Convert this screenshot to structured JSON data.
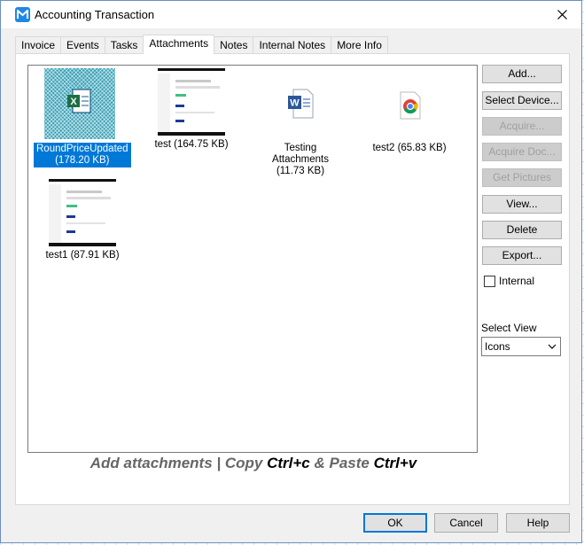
{
  "window": {
    "title": "Accounting Transaction",
    "accent": "#0078d7"
  },
  "tabs": [
    {
      "label": "Invoice"
    },
    {
      "label": "Events"
    },
    {
      "label": "Tasks"
    },
    {
      "label": "Attachments",
      "active": true
    },
    {
      "label": "Notes"
    },
    {
      "label": "Internal Notes"
    },
    {
      "label": "More Info"
    }
  ],
  "attachments": [
    {
      "name": "RoundPriceUpdated",
      "size": "(178.20 KB)",
      "icon": "excel-file-icon",
      "selected": true
    },
    {
      "name": "test (164.75 KB)",
      "size": "",
      "icon": "screenshot-thumbnail"
    },
    {
      "name": "Testing Attachments",
      "size": "(11.73 KB)",
      "icon": "word-file-icon"
    },
    {
      "name": "test2 (65.83 KB)",
      "size": "",
      "icon": "chrome-file-icon"
    },
    {
      "name": "test1 (87.91 KB)",
      "size": "",
      "icon": "screenshot-thumbnail"
    }
  ],
  "buttons": {
    "add": "Add...",
    "select_device": "Select Device...",
    "acquire": "Acquire...",
    "acquire_doc": "Acquire Doc...",
    "get_pictures": "Get Pictures",
    "view": "View...",
    "delete": "Delete",
    "export": "Export..."
  },
  "internal_checkbox": {
    "label": "Internal",
    "checked": false
  },
  "select_view": {
    "label": "Select View",
    "value": "Icons"
  },
  "hint": {
    "part1": "Add attachments | Copy ",
    "copy_key": "Ctrl+c",
    "part2": " & Paste ",
    "paste_key": "Ctrl+v"
  },
  "footer": {
    "ok": "OK",
    "cancel": "Cancel",
    "help": "Help"
  }
}
